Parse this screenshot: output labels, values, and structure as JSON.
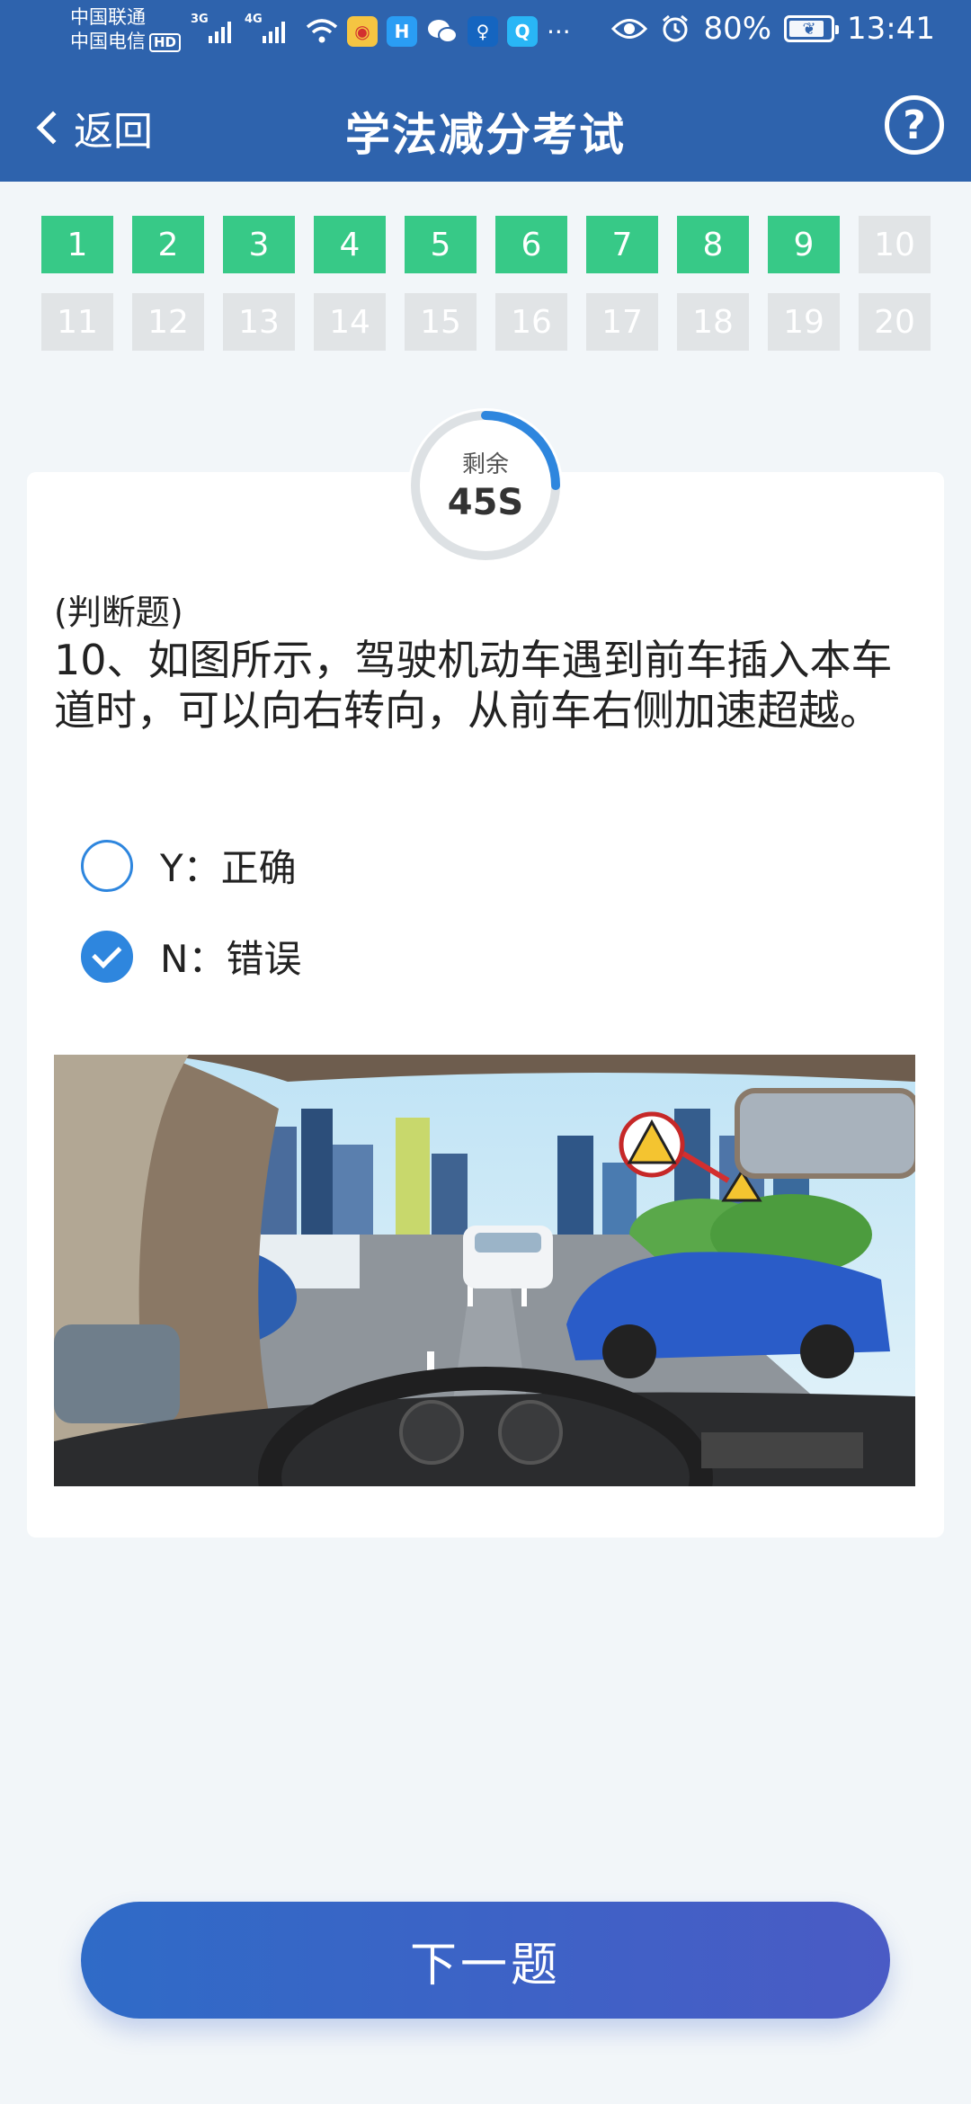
{
  "status_bar": {
    "carrier_1": "中国联通",
    "carrier_2": "中国电信",
    "hd_badge": "HD",
    "net_1": "3G",
    "net_2": "4G",
    "more": "···",
    "battery": "80%",
    "time": "13:41"
  },
  "nav": {
    "back_label": "返回",
    "title": "学法减分考试",
    "help_label": "?"
  },
  "questions": {
    "row1": [
      {
        "n": "1",
        "state": "done"
      },
      {
        "n": "2",
        "state": "done"
      },
      {
        "n": "3",
        "state": "done"
      },
      {
        "n": "4",
        "state": "done"
      },
      {
        "n": "5",
        "state": "done"
      },
      {
        "n": "6",
        "state": "done"
      },
      {
        "n": "7",
        "state": "done"
      },
      {
        "n": "8",
        "state": "done"
      },
      {
        "n": "9",
        "state": "done"
      },
      {
        "n": "10",
        "state": "todo"
      }
    ],
    "row2": [
      {
        "n": "11",
        "state": "todo"
      },
      {
        "n": "12",
        "state": "todo"
      },
      {
        "n": "13",
        "state": "todo"
      },
      {
        "n": "14",
        "state": "todo"
      },
      {
        "n": "15",
        "state": "todo"
      },
      {
        "n": "16",
        "state": "todo"
      },
      {
        "n": "17",
        "state": "todo"
      },
      {
        "n": "18",
        "state": "todo"
      },
      {
        "n": "19",
        "state": "todo"
      },
      {
        "n": "20",
        "state": "todo"
      }
    ]
  },
  "timer": {
    "label": "剩余",
    "value": "45S",
    "fraction_remaining": 0.25
  },
  "question": {
    "type": "(判断题)",
    "text": "10、如图所示，驾驶机动车遇到前车插入本车道时，可以向右转向，从前车右侧加速超越。",
    "options": [
      {
        "label": "Y：正确",
        "selected": false
      },
      {
        "label": "N：错误",
        "selected": true
      }
    ]
  },
  "next_button": "下一题",
  "colors": {
    "header": "#2e63ad",
    "answered": "#37c987",
    "unanswered": "#e1e4e6",
    "accent": "#2e86de"
  }
}
